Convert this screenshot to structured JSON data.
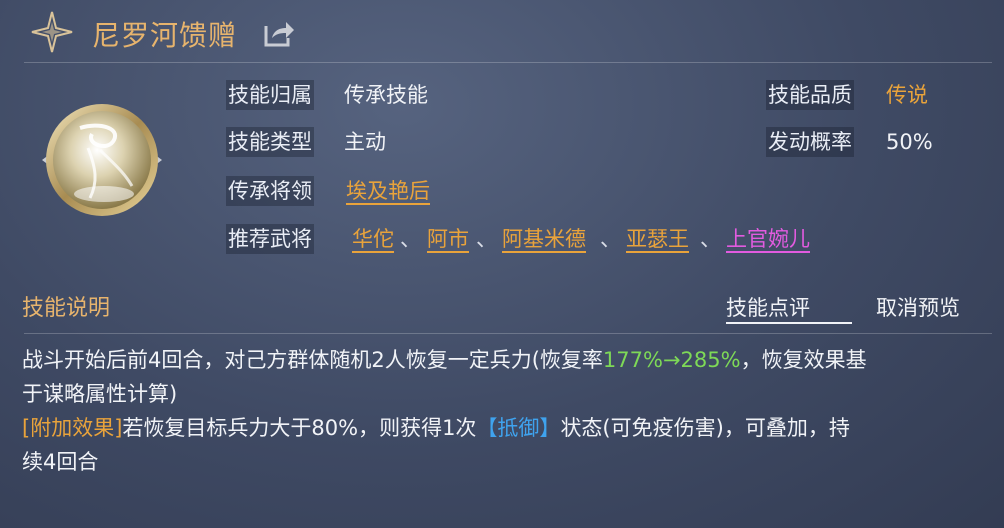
{
  "header": {
    "title": "尼罗河馈赠",
    "icons": [
      "four-point-star-icon",
      "share-icon"
    ]
  },
  "skill_icon": "wind-swirl-skill-icon",
  "attributes": {
    "category_label": "技能归属",
    "category_value": "传承技能",
    "quality_label": "技能品质",
    "quality_value": "传说",
    "type_label": "技能类型",
    "type_value": "主动",
    "chance_label": "发动概率",
    "chance_value": "50%",
    "inherit_label": "传承将领",
    "inherit_value": "埃及艳后",
    "recommend_label": "推荐武将",
    "recommended": [
      "华佗",
      "阿市",
      "阿基米德",
      "亚瑟王",
      "上官婉儿"
    ],
    "separator": "、"
  },
  "section": {
    "title": "技能说明",
    "tab_review": "技能点评",
    "tab_cancel": "取消预览"
  },
  "description": {
    "line1_a": "战斗开始后前4回合，对己方群体随机2人恢复一定兵力(恢复率",
    "line1_rate": "177%→285%",
    "line1_b": "，恢复效果基",
    "line2": "于谋略属性计算)",
    "line3_tag": "[附加效果]",
    "line3_a": "若恢复目标兵力大于80%，则获得1次",
    "line3_status": "【抵御】",
    "line3_b": "状态(可免疫伤害)，可叠加，持",
    "line4": "续4回合"
  },
  "colors": {
    "title_gold": "#e7b46d",
    "legend_orange": "#e9a33b",
    "pink": "#e25be0",
    "green": "#7ed957",
    "blue": "#3fa3ee"
  }
}
